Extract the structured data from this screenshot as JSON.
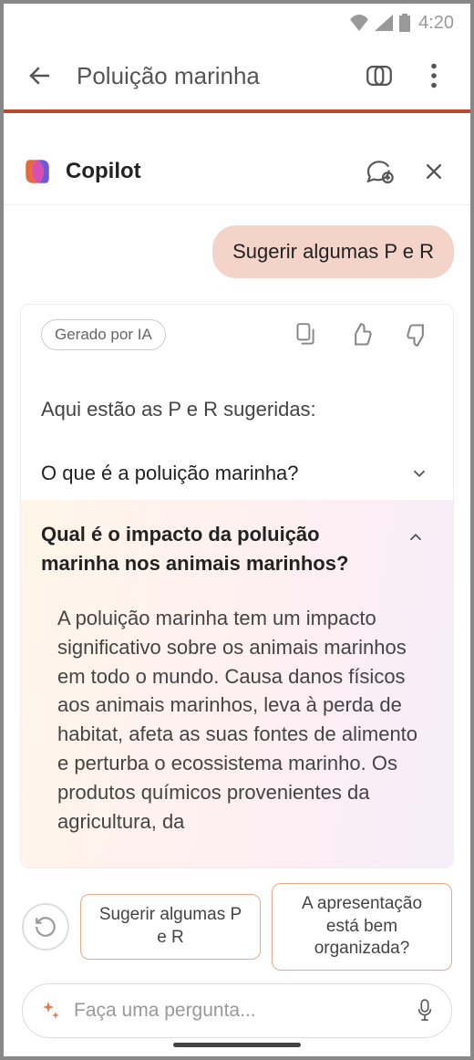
{
  "status": {
    "time": "4:20"
  },
  "header": {
    "title": "Poluição marinha"
  },
  "copilot": {
    "title": "Copilot"
  },
  "chat": {
    "user_message": "Sugerir algumas P e R",
    "badge": "Gerado por IA",
    "intro": "Aqui estão as P e R sugeridas:",
    "qa": [
      {
        "q": "O que é a poluição marinha?",
        "expanded": false
      },
      {
        "q": "Qual é o impacto da poluição marinha nos animais marinhos?",
        "expanded": true,
        "a": "A poluição marinha tem um impacto significativo sobre os animais marinhos em todo o mundo. Causa danos físicos aos animais marinhos, leva à perda de habitat, afeta as suas fontes de alimento e perturba o ecossistema marinho. Os produtos químicos provenientes da agricultura, da"
      }
    ]
  },
  "suggestions": {
    "chip1": "Sugerir algumas P e R",
    "chip2": "A apresentação está bem organizada?"
  },
  "input": {
    "placeholder": "Faça uma pergunta..."
  }
}
